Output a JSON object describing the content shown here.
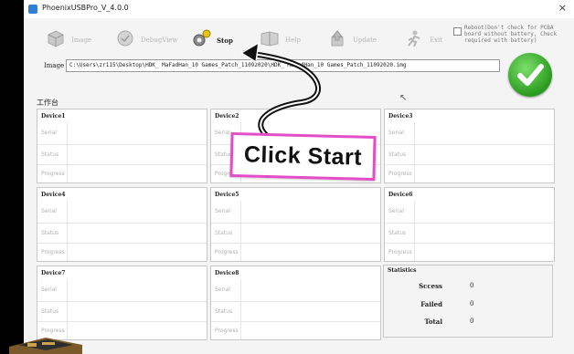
{
  "window": {
    "title": "PhoenixUSBPro_V_4.0.0",
    "close": "×"
  },
  "toolbar": {
    "image": "Image",
    "debugview": "DebugView",
    "stop": "Stop",
    "help": "Help",
    "update": "Update",
    "exit": "Exit"
  },
  "reboot_option": {
    "text": "Reboot(Don't check for PCBA board without battery, Check required with battery)",
    "checked": false
  },
  "image_path": {
    "label": "Image",
    "value": "C:\\Users\\zr115\\Desktop\\HDK_ MaFadHan_10 Games_Patch_11092020\\HDK_ MaFadHan_10 Games_Patch_11092020.img"
  },
  "status_color": "#2c9a1f",
  "group_label": "工作台",
  "row_labels": {
    "serial": "Serial",
    "status": "Status",
    "progress": "Progress"
  },
  "devices": [
    {
      "name": "Device1"
    },
    {
      "name": "Device2"
    },
    {
      "name": "Device3"
    },
    {
      "name": "Device4"
    },
    {
      "name": "Device5"
    },
    {
      "name": "Device6"
    },
    {
      "name": "Device7"
    },
    {
      "name": "Device8"
    }
  ],
  "statistics": {
    "title": "Statistics",
    "success_label": "Sccess",
    "success_value": "0",
    "failed_label": "Failed",
    "failed_value": "0",
    "total_label": "Total",
    "total_value": "0"
  },
  "overlay": {
    "callout": "Click Start",
    "accent": "#e24ec8"
  }
}
